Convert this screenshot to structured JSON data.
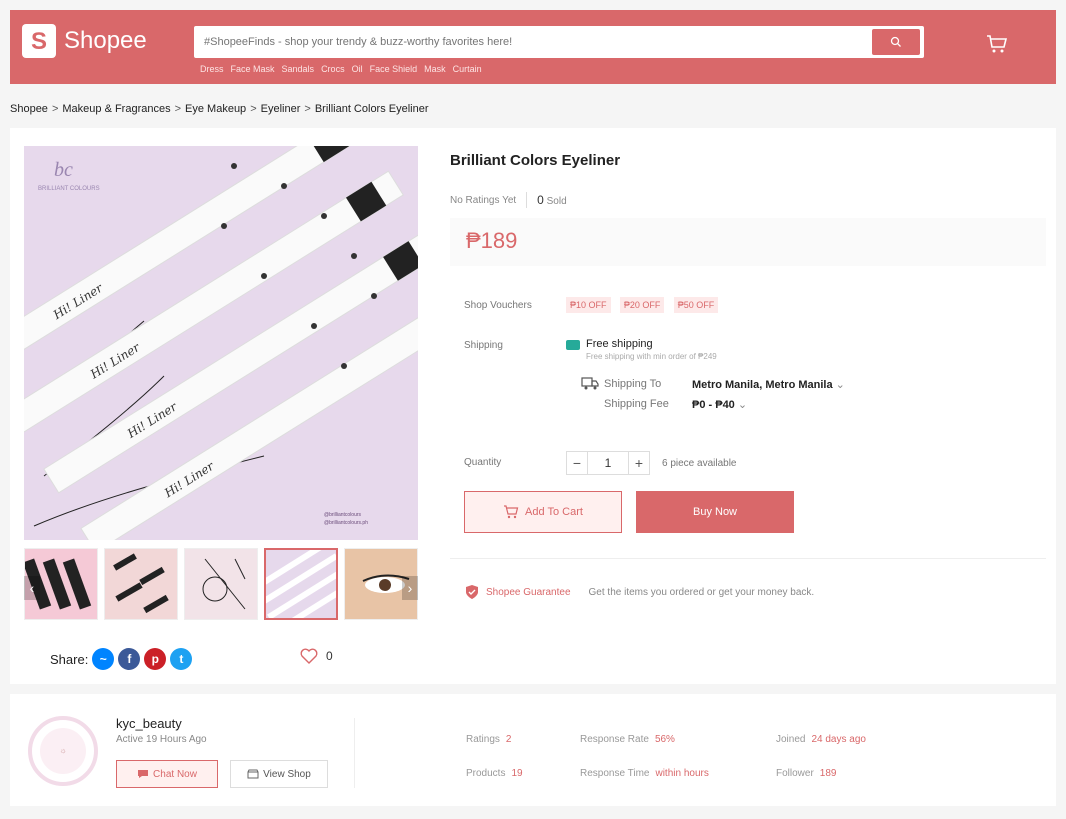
{
  "header": {
    "logo_letter": "S",
    "logo_text": "Shopee",
    "search_placeholder": "#ShopeeFinds - shop your trendy & buzz-worthy favorites here!",
    "hot_keywords": [
      "Dress",
      "Face Mask",
      "Sandals",
      "Crocs",
      "Oil",
      "Face Shield",
      "Mask",
      "Curtain"
    ]
  },
  "breadcrumb": [
    "Shopee",
    "Makeup & Fragrances",
    "Eye Makeup",
    "Eyeliner",
    "Brilliant Colors Eyeliner"
  ],
  "product": {
    "title": "Brilliant Colors Eyeliner",
    "ratings_text": "No Ratings Yet",
    "sold_count": "0",
    "sold_label": "Sold",
    "price": "₱189",
    "image_brand_text": "BRILLIANT COLOURS",
    "image_handles": [
      "@brilliantcolours",
      "@brilliantcolours.ph"
    ],
    "vouchers_label": "Shop Vouchers",
    "vouchers": [
      "₱10 OFF",
      "₱20 OFF",
      "₱50 OFF"
    ],
    "shipping_label": "Shipping",
    "free_shipping_title": "Free shipping",
    "free_shipping_desc": "Free shipping with min order of ₱249",
    "shipping_to_label": "Shipping To",
    "shipping_to_value": "Metro Manila, Metro Manila",
    "shipping_fee_label": "Shipping Fee",
    "shipping_fee_value": "₱0 - ₱40",
    "quantity_label": "Quantity",
    "quantity_value": "1",
    "pieces_available": "6 piece available",
    "add_to_cart_label": "Add To Cart",
    "buy_now_label": "Buy Now",
    "guarantee_title": "Shopee Guarantee",
    "guarantee_desc": "Get the items you ordered or get your money back.",
    "share_label": "Share:",
    "favorites_count": "0"
  },
  "shop": {
    "name": "kyc_beauty",
    "active": "Active 19 Hours Ago",
    "chat_label": "Chat Now",
    "view_label": "View Shop",
    "stats": {
      "ratings_label": "Ratings",
      "ratings_value": "2",
      "response_rate_label": "Response Rate",
      "response_rate_value": "56%",
      "joined_label": "Joined",
      "joined_value": "24 days ago",
      "products_label": "Products",
      "products_value": "19",
      "response_time_label": "Response Time",
      "response_time_value": "within hours",
      "follower_label": "Follower",
      "follower_value": "189"
    }
  },
  "colors": {
    "brand": "#d9686a",
    "free_ship": "#26aa99"
  }
}
